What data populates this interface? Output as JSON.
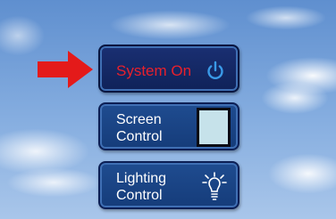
{
  "buttons": {
    "system": {
      "label": "System On",
      "icon": "power-icon",
      "state": "on"
    },
    "screen": {
      "label": "Screen\nControl",
      "icon": "screen-icon"
    },
    "lighting": {
      "label": "Lighting\nControl",
      "icon": "lightbulb-icon"
    }
  },
  "indicator": {
    "icon": "arrow-right-icon"
  },
  "colors": {
    "active_text": "#e8202c",
    "button_fill": "#153c7a",
    "active_fill": "#0f2259",
    "arrow": "#e41a1a",
    "icon_accent": "#3a9ae8"
  }
}
